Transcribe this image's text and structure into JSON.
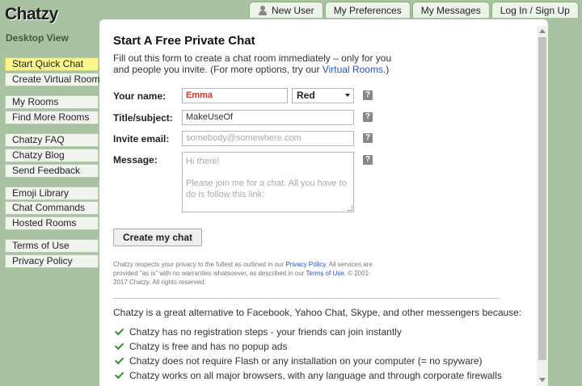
{
  "brand": {
    "logo": "Chatzy",
    "view": "Desktop View"
  },
  "topnav": [
    "New User",
    "My Preferences",
    "My Messages",
    "Log In / Sign Up"
  ],
  "sidebar": {
    "items": [
      "Start Quick Chat",
      "Create Virtual Room",
      "My Rooms",
      "Find More Rooms",
      "Chatzy FAQ",
      "Chatzy Blog",
      "Send Feedback",
      "Emoji Library",
      "Chat Commands",
      "Hosted Rooms",
      "Terms of Use",
      "Privacy Policy"
    ]
  },
  "form": {
    "title": "Start A Free Private Chat",
    "intro_before": "Fill out this form to create a chat room immediately – only for you and people you invite. (For more options, try our ",
    "intro_link": "Virtual Rooms",
    "intro_after": ".)",
    "name_label": "Your name:",
    "name_value": "Emma",
    "color_value": "Red",
    "subject_label": "Title/subject:",
    "subject_value": "MakeUseOf",
    "email_label": "Invite email:",
    "email_placeholder": "somebody@somewhere.com",
    "message_label": "Message:",
    "message_line1": "Hi there!",
    "message_line2": "Please join me for a chat. All you have to do is follow this link:",
    "help_glyph": "?",
    "submit": "Create my chat"
  },
  "privacy": {
    "p1": "Chatzy respects your privacy to the fullest as outlined in our ",
    "privacy_link": "Privacy Policy",
    "p2": ". All services are provided \"as is\" with no warranties whatsoever, as described in our ",
    "terms_link": "Terms of Use",
    "p3": ". © 2001-2017 Chatzy. All rights reserved."
  },
  "why": {
    "heading": "Chatzy is a great alternative to Facebook, Yahoo Chat, Skype, and other messengers because:",
    "points": [
      "Chatzy has no registration steps - your friends can join instantly",
      "Chatzy is free and has no popup ads",
      "Chatzy does not require Flash or any installation on your computer (= no spyware)",
      "Chatzy works on all major browsers, with any language and through corporate firewalls"
    ]
  },
  "colors": {
    "background": "#a9c3a2",
    "active_item": "#fbf58c",
    "link": "#2a4fc7",
    "name_text": "#e0302c",
    "check": "#2c8e2c"
  }
}
